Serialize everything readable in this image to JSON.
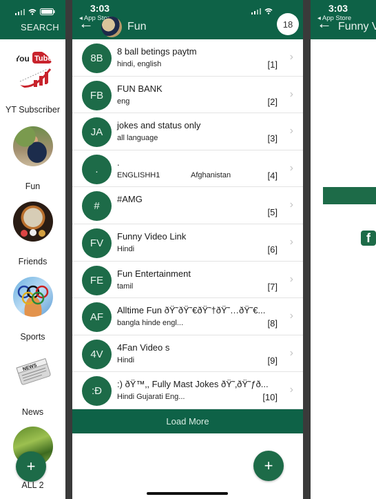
{
  "status_bar": {
    "time": "3:03",
    "back_app": "App Store"
  },
  "left_panel": {
    "search_label": "SEARCH",
    "categories": [
      {
        "label": "YT Subscriber",
        "icon": "youtube-chart-icon"
      },
      {
        "label": "Fun",
        "icon": "child-photo"
      },
      {
        "label": "Friends",
        "icon": "globe-friends-photo"
      },
      {
        "label": "Sports",
        "icon": "olympic-rings-photo"
      },
      {
        "label": "News",
        "icon": "newspaper-icon"
      },
      {
        "label": "ALL 2",
        "icon": "nature-photo"
      }
    ],
    "fab_label": "+"
  },
  "middle_panel": {
    "title": "Fun",
    "badge_count": "18",
    "groups": [
      {
        "initials": "8B",
        "name": "8 ball betings paytm",
        "language": "hindi, english",
        "country": "",
        "index": "[1]"
      },
      {
        "initials": "FB",
        "name": "FUN BANK",
        "language": "eng",
        "country": "",
        "index": "[2]"
      },
      {
        "initials": "JA",
        "name": "jokes and status only",
        "language": "all language",
        "country": "",
        "index": "[3]"
      },
      {
        "initials": ".",
        "name": ".",
        "language": "ENGLISHH1",
        "country": "Afghanistan",
        "index": "[4]"
      },
      {
        "initials": "#",
        "name": "#AMG",
        "language": "",
        "country": "",
        "index": "[5]"
      },
      {
        "initials": "FV",
        "name": "Funny Video Link",
        "language": "Hindi",
        "country": "",
        "index": "[6]"
      },
      {
        "initials": "FE",
        "name": "Fun Entertainment",
        "language": "tamil",
        "country": "",
        "index": "[7]"
      },
      {
        "initials": "AF",
        "name": "Alltime Fun ðŸ˜ðŸ˜€ðŸ˜†ðŸ˜…ðŸ˜€...",
        "language": "bangla hinde engl...",
        "country": "",
        "index": "[8]"
      },
      {
        "initials": "4V",
        "name": "4Fan Video s",
        "language": "Hindi",
        "country": "",
        "index": "[9]"
      },
      {
        "initials": ":Ð",
        "name": ":) ðŸ™‚, Fully Mast Jokes ðŸ˜‚ðŸ˜ƒð...",
        "language": "Hindi Gujarati Eng...",
        "country": "",
        "index": "[10]"
      }
    ],
    "load_more_label": "Load More",
    "fab_label": "+",
    "chevron": "›"
  },
  "right_panel": {
    "title": "Funny Video Link",
    "facebook_glyph": "f"
  },
  "colors": {
    "brand_green": "#0e6247",
    "avatar_green": "#1d6b48",
    "divider": "#3a3a3a"
  }
}
